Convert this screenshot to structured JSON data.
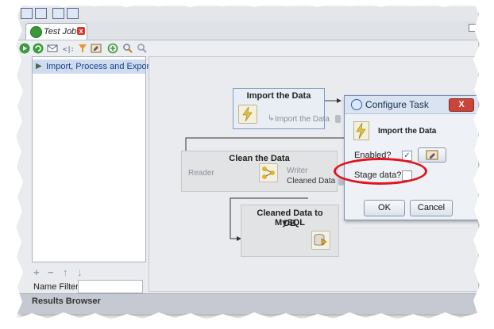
{
  "tab": {
    "label": "Test Job",
    "close": "x"
  },
  "tree": {
    "items": [
      {
        "label": "Import, Process and Export"
      }
    ]
  },
  "left": {
    "name_filter_label": "Name Filter",
    "name_filter_value": "",
    "add": "+",
    "remove": "−",
    "up": "↑",
    "down": "↓"
  },
  "canvas": {
    "import_task": {
      "title": "Import the Data",
      "output": "Import the Data"
    },
    "clean_task": {
      "title": "Clean the Data",
      "input": "Reader",
      "output_label": "Writer",
      "output_name": "Cleaned Data"
    },
    "mysql_task": {
      "title_line1": "Cleaned Data to MySQL",
      "title_line2": "DB"
    }
  },
  "results_bar": {
    "label": "Results Browser"
  },
  "dialog": {
    "title": "Configure Task",
    "close": "X",
    "task_name": "Import the Data",
    "enabled_label": "Enabled?",
    "enabled_checked": "✓",
    "stage_label": "Stage data?",
    "ok": "OK",
    "cancel": "Cancel"
  },
  "colors": {
    "highlight": "#e0141e",
    "selection": "#cfdcf0",
    "accent": "#2d5fa8"
  }
}
